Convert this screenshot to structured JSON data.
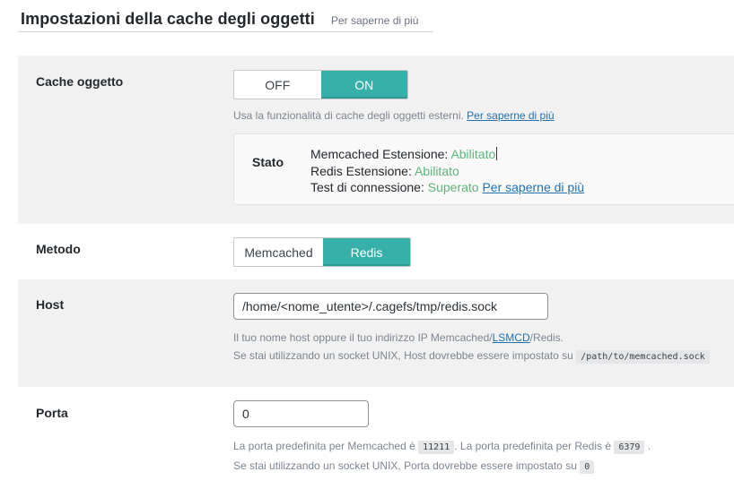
{
  "header": {
    "title": "Impostazioni della cache degli oggetti",
    "learn_more": "Per saperne di più"
  },
  "object_cache": {
    "label": "Cache oggetto",
    "off_label": "OFF",
    "on_label": "ON",
    "selected": "ON",
    "help_text": "Usa la funzionalità di cache degli oggetti esterni.",
    "help_link": "Per saperne di più",
    "status": {
      "label": "Stato",
      "memcached_label": "Memcached Estensione:",
      "memcached_value": "Abilitato",
      "redis_label": "Redis Estensione:",
      "redis_value": "Abilitato",
      "connection_label": "Test di connessione:",
      "connection_value": "Superato",
      "learn_more": "Per saperne di più"
    }
  },
  "method": {
    "label": "Metodo",
    "options": [
      "Memcached",
      "Redis"
    ],
    "selected": "Redis"
  },
  "host": {
    "label": "Host",
    "value": "/home/<nome_utente>/.cagefs/tmp/redis.sock",
    "help_line1_pre": "Il tuo nome host oppure il tuo indirizzo IP Memcached/",
    "help_line1_link": "LSMCD",
    "help_line1_post": "/Redis.",
    "help_line2": "Se stai utilizzando un socket UNIX, Host dovrebbe essere impostato su",
    "help_line2_code": "/path/to/memcached.sock"
  },
  "port": {
    "label": "Porta",
    "value": "0",
    "help_line1_a": "La porta predefinita per Memcached è",
    "help_line1_code1": "11211",
    "help_line1_b": ". La porta predefinita per Redis è",
    "help_line1_code2": "6379",
    "help_line1_c": ".",
    "help_line2": "Se stai utilizzando un socket UNIX, Porta dovrebbe essere impostato su",
    "help_line2_code": "0"
  },
  "colors": {
    "accent": "#36b0a8",
    "success": "#5fb47a",
    "link": "#2271b1"
  }
}
